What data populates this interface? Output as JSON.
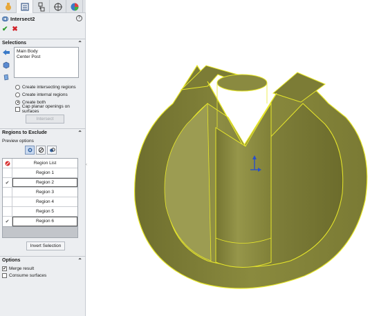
{
  "pm_tabs": [
    {
      "icon": "feature-manager-icon",
      "active": false
    },
    {
      "icon": "property-manager-icon",
      "active": true
    },
    {
      "icon": "configuration-manager-icon",
      "active": false
    },
    {
      "icon": "dimxpert-icon",
      "active": false
    },
    {
      "icon": "display-manager-icon",
      "active": false
    }
  ],
  "feature": {
    "title": "Intersect2",
    "help_label": "?",
    "ok_label": "✔",
    "cancel_label": "✖"
  },
  "selections": {
    "header": "Selections",
    "items": [
      "Main Body",
      "Center Post"
    ],
    "radio_options": [
      {
        "label": "Create intersecting regions",
        "checked": false
      },
      {
        "label": "Create internal regions",
        "checked": false
      },
      {
        "label": "Create both",
        "checked": true
      }
    ],
    "cap_label": "Cap planar openings on surfaces",
    "cap_checked": false,
    "intersect_button": "Intersect"
  },
  "regions": {
    "header": "Regions to Exclude",
    "preview_label": "Preview options",
    "column_header": "Region List",
    "rows": [
      {
        "label": "Region   1",
        "checked": false
      },
      {
        "label": "Region   2",
        "checked": true
      },
      {
        "label": "Region   3",
        "checked": false
      },
      {
        "label": "Region   4",
        "checked": false
      },
      {
        "label": "Region   5",
        "checked": false
      },
      {
        "label": "Region   6",
        "checked": true
      }
    ],
    "invert_button": "Invert Selection"
  },
  "options": {
    "header": "Options",
    "merge_label": "Merge result",
    "merge_checked": true,
    "consume_label": "Consume surfaces",
    "consume_checked": false
  },
  "colors": {
    "model_fill": "#8a8a3e",
    "model_edge": "#e8e82a",
    "panel_bg": "#eceef1"
  }
}
